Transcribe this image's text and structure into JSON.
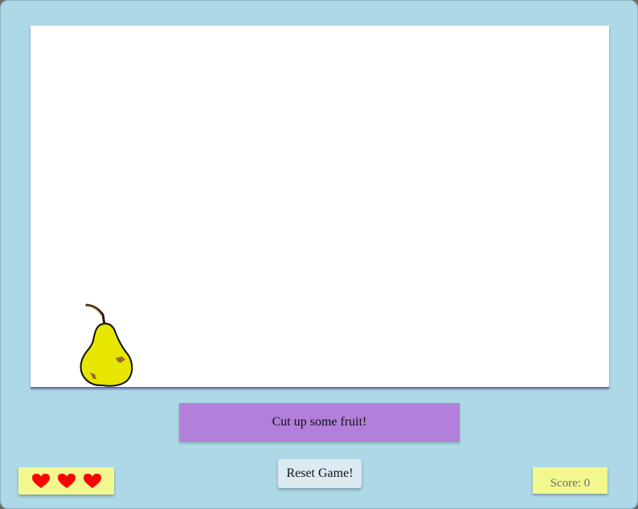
{
  "game": {
    "message": "Cut up some fruit!",
    "reset_label": "Reset Game!",
    "score_label": "Score: 0",
    "score": 0,
    "lives": 3,
    "fruit_name": "pear-icon",
    "heart_icon": "heart-icon",
    "colors": {
      "background": "#add8e6",
      "message_bg": "#b27fda",
      "panel_bg": "#f2f88e",
      "heart": "#ff0000",
      "fruit": "#e6e600"
    }
  }
}
